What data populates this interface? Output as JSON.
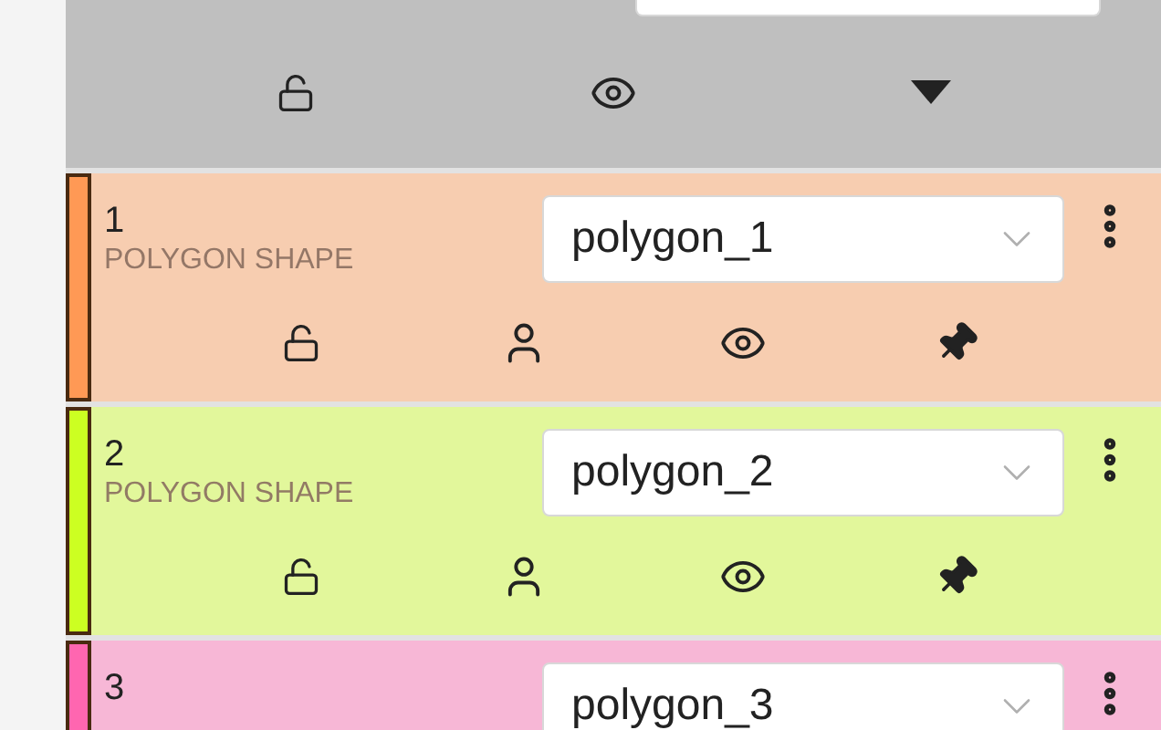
{
  "header": {
    "locked": false,
    "visible": true
  },
  "layers": [
    {
      "number": "1",
      "type_label": "POLYGON SHAPE",
      "value": "polygon_1",
      "color": "#ff9955",
      "locked": false,
      "visible": true,
      "pinned": true
    },
    {
      "number": "2",
      "type_label": "POLYGON SHAPE",
      "value": "polygon_2",
      "color": "#ccff22",
      "locked": false,
      "visible": true,
      "pinned": true
    },
    {
      "number": "3",
      "value": "polygon_3",
      "color": "#ff66b0"
    }
  ]
}
